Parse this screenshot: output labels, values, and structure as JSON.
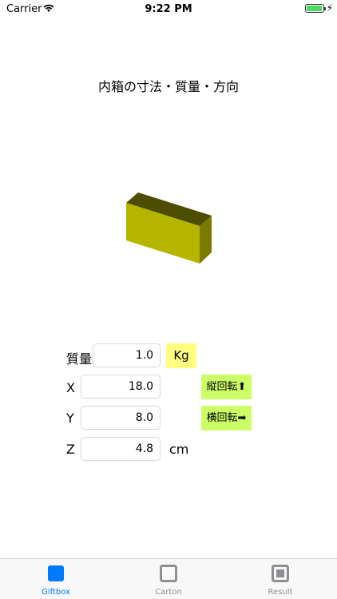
{
  "status": {
    "carrier": "Carrier",
    "time": "9:22 PM"
  },
  "title": "内箱の寸法・質量・方向",
  "form": {
    "mass_label": "質量",
    "mass_value": "1.0",
    "mass_unit": "Kg",
    "x_label": "X",
    "x_value": "18.0",
    "y_label": "Y",
    "y_value": "8.0",
    "z_label": "Z",
    "z_value": "4.8",
    "dim_unit": "cm"
  },
  "buttons": {
    "rotate_vertical": "縦回転⬆",
    "rotate_horizontal": "横回転➡"
  },
  "box_colors": {
    "front": "#b5b500",
    "top": "#4d4d00",
    "side": "#7a7a00"
  },
  "tabs": [
    {
      "label": "Giftbox",
      "active": true,
      "icon": "square-filled-icon"
    },
    {
      "label": "Carton",
      "active": false,
      "icon": "square-outline-icon"
    },
    {
      "label": "Result",
      "active": false,
      "icon": "square-outline-icon"
    }
  ],
  "colors": {
    "accent": "#007aff",
    "inactive": "#8e8e93",
    "kg_bg": "#ffff80",
    "button_bg": "#ccff66"
  }
}
